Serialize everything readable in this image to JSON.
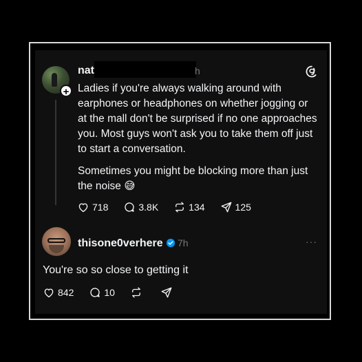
{
  "main_post": {
    "username": "nat",
    "time_fragment": "h",
    "paragraph1": "Ladies if you're always walking around with earphones or headphones on whether jogging or at the mall  don't be surprised if no one approaches you. Most guys won't ask you to take them off just to start a conversation.",
    "paragraph2": "Sometimes you might be blocking more than just the noise 😅",
    "likes": "718",
    "replies": "3.8K",
    "reposts": "134",
    "shares": "125",
    "follow_plus": "+"
  },
  "reply": {
    "username": "thisone0verhere",
    "time": "7h",
    "text": "You're so so close to getting it",
    "likes": "842",
    "replies": "10",
    "more": "···"
  },
  "icons": [
    "follow-plus-icon",
    "threads-logo-icon",
    "heart-icon",
    "comment-icon",
    "repost-icon",
    "share-icon",
    "verified-icon",
    "more-icon"
  ],
  "colors": {
    "background": "#000000",
    "card": "#101010",
    "text": "#f3f5f7",
    "muted": "#777777",
    "verified": "#0095f6"
  }
}
